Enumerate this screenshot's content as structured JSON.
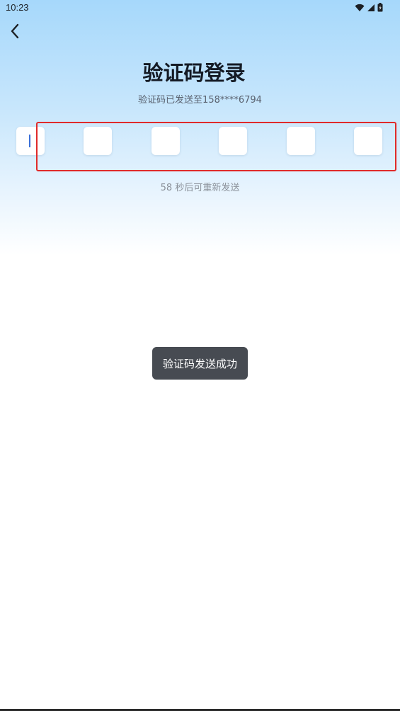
{
  "status_bar": {
    "time": "10:23",
    "icons": [
      "wifi-icon",
      "signal-icon",
      "battery-icon"
    ]
  },
  "header": {
    "back_icon": "chevron-left-icon",
    "title": "验证码登录",
    "subtitle": "验证码已发送至158****6794"
  },
  "otp": {
    "length": 6,
    "values": [
      "",
      "",
      "",
      "",
      "",
      ""
    ],
    "active_index": 0
  },
  "resend": {
    "text": "58 秒后可重新发送"
  },
  "toast": {
    "text": "验证码发送成功"
  },
  "colors": {
    "highlight": "#e02a2a",
    "cursor": "#3a6fd8",
    "toast_bg": "#474b52"
  }
}
